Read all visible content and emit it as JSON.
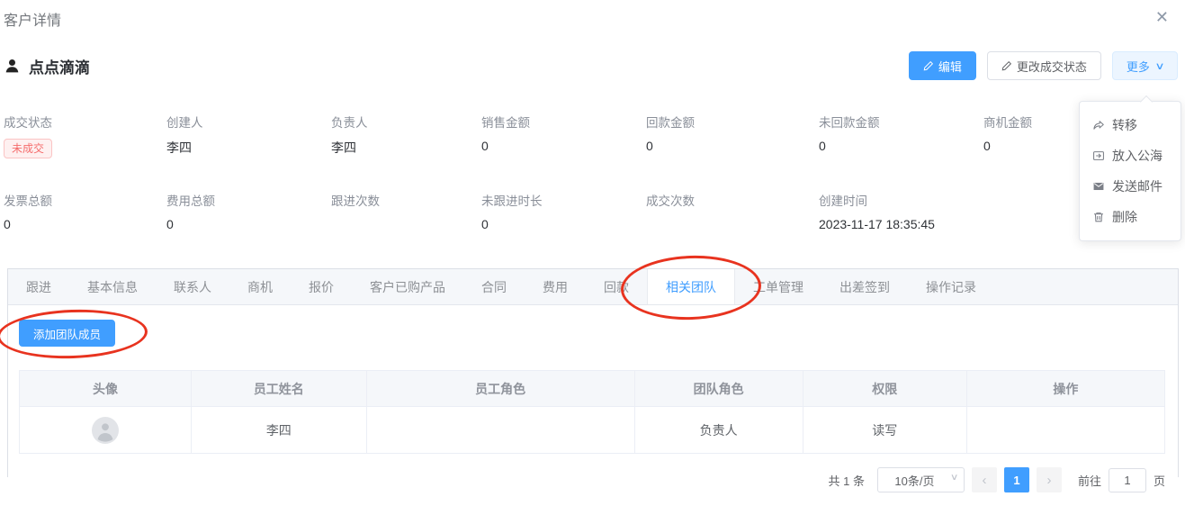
{
  "drawer": {
    "title": "客户详情"
  },
  "icons": {
    "close": "✕",
    "caret_down": "∨",
    "chevron_left": "‹",
    "chevron_right": "›"
  },
  "customer": {
    "name": "点点滴滴",
    "actions": {
      "edit": "编辑",
      "change_deal_status": "更改成交状态",
      "more": "更多"
    },
    "more_menu": [
      {
        "icon": "transfer-icon",
        "label": "转移"
      },
      {
        "icon": "move-to-pool-icon",
        "label": "放入公海"
      },
      {
        "icon": "send-mail-icon",
        "label": "发送邮件"
      },
      {
        "icon": "delete-icon",
        "label": "删除"
      }
    ]
  },
  "fields_row1": [
    {
      "label": "成交状态",
      "value": "未成交",
      "type": "badge"
    },
    {
      "label": "创建人",
      "value": "李四"
    },
    {
      "label": "负责人",
      "value": "李四"
    },
    {
      "label": "销售金额",
      "value": "0"
    },
    {
      "label": "回款金额",
      "value": "0"
    },
    {
      "label": "未回款金额",
      "value": "0"
    },
    {
      "label": "商机金额",
      "value": "0"
    }
  ],
  "fields_row2": [
    {
      "label": "发票总额",
      "value": "0"
    },
    {
      "label": "费用总额",
      "value": "0"
    },
    {
      "label": "跟进次数",
      "value": ""
    },
    {
      "label": "未跟进时长",
      "value": "0"
    },
    {
      "label": "成交次数",
      "value": ""
    },
    {
      "label": "创建时间",
      "value": "2023-11-17 18:35:45"
    }
  ],
  "tabs": [
    "跟进",
    "基本信息",
    "联系人",
    "商机",
    "报价",
    "客户已购产品",
    "合同",
    "费用",
    "回款",
    "相关团队",
    "工单管理",
    "出差签到",
    "操作记录"
  ],
  "active_tab": "相关团队",
  "team_panel": {
    "add_button": "添加团队成员",
    "table": {
      "columns": [
        "头像",
        "员工姓名",
        "员工角色",
        "团队角色",
        "权限",
        "操作"
      ],
      "rows": [
        {
          "avatar": "person-avatar",
          "name": "李四",
          "employee_role": "",
          "team_role": "负责人",
          "permission": "读写",
          "operation": ""
        }
      ]
    },
    "pagination": {
      "total": "共 1 条",
      "page_size": "10条/页",
      "current_page": "1",
      "goto_label": "前往",
      "goto_value": "1",
      "goto_suffix": "页"
    }
  },
  "annotations": {
    "color": "#e8331f",
    "circled": [
      "相关团队 tab",
      "添加团队成员 button"
    ]
  },
  "colors": {
    "primary": "#409eff",
    "primary_soft_bg": "#ecf5ff",
    "danger_text": "#f56c6c",
    "danger_bg": "#fef0f0",
    "danger_border": "#fbc4c4",
    "tab_bar_bg": "#f5f7fa",
    "table_header_bg": "#f5f7fa",
    "border": "#dcdfe6"
  }
}
